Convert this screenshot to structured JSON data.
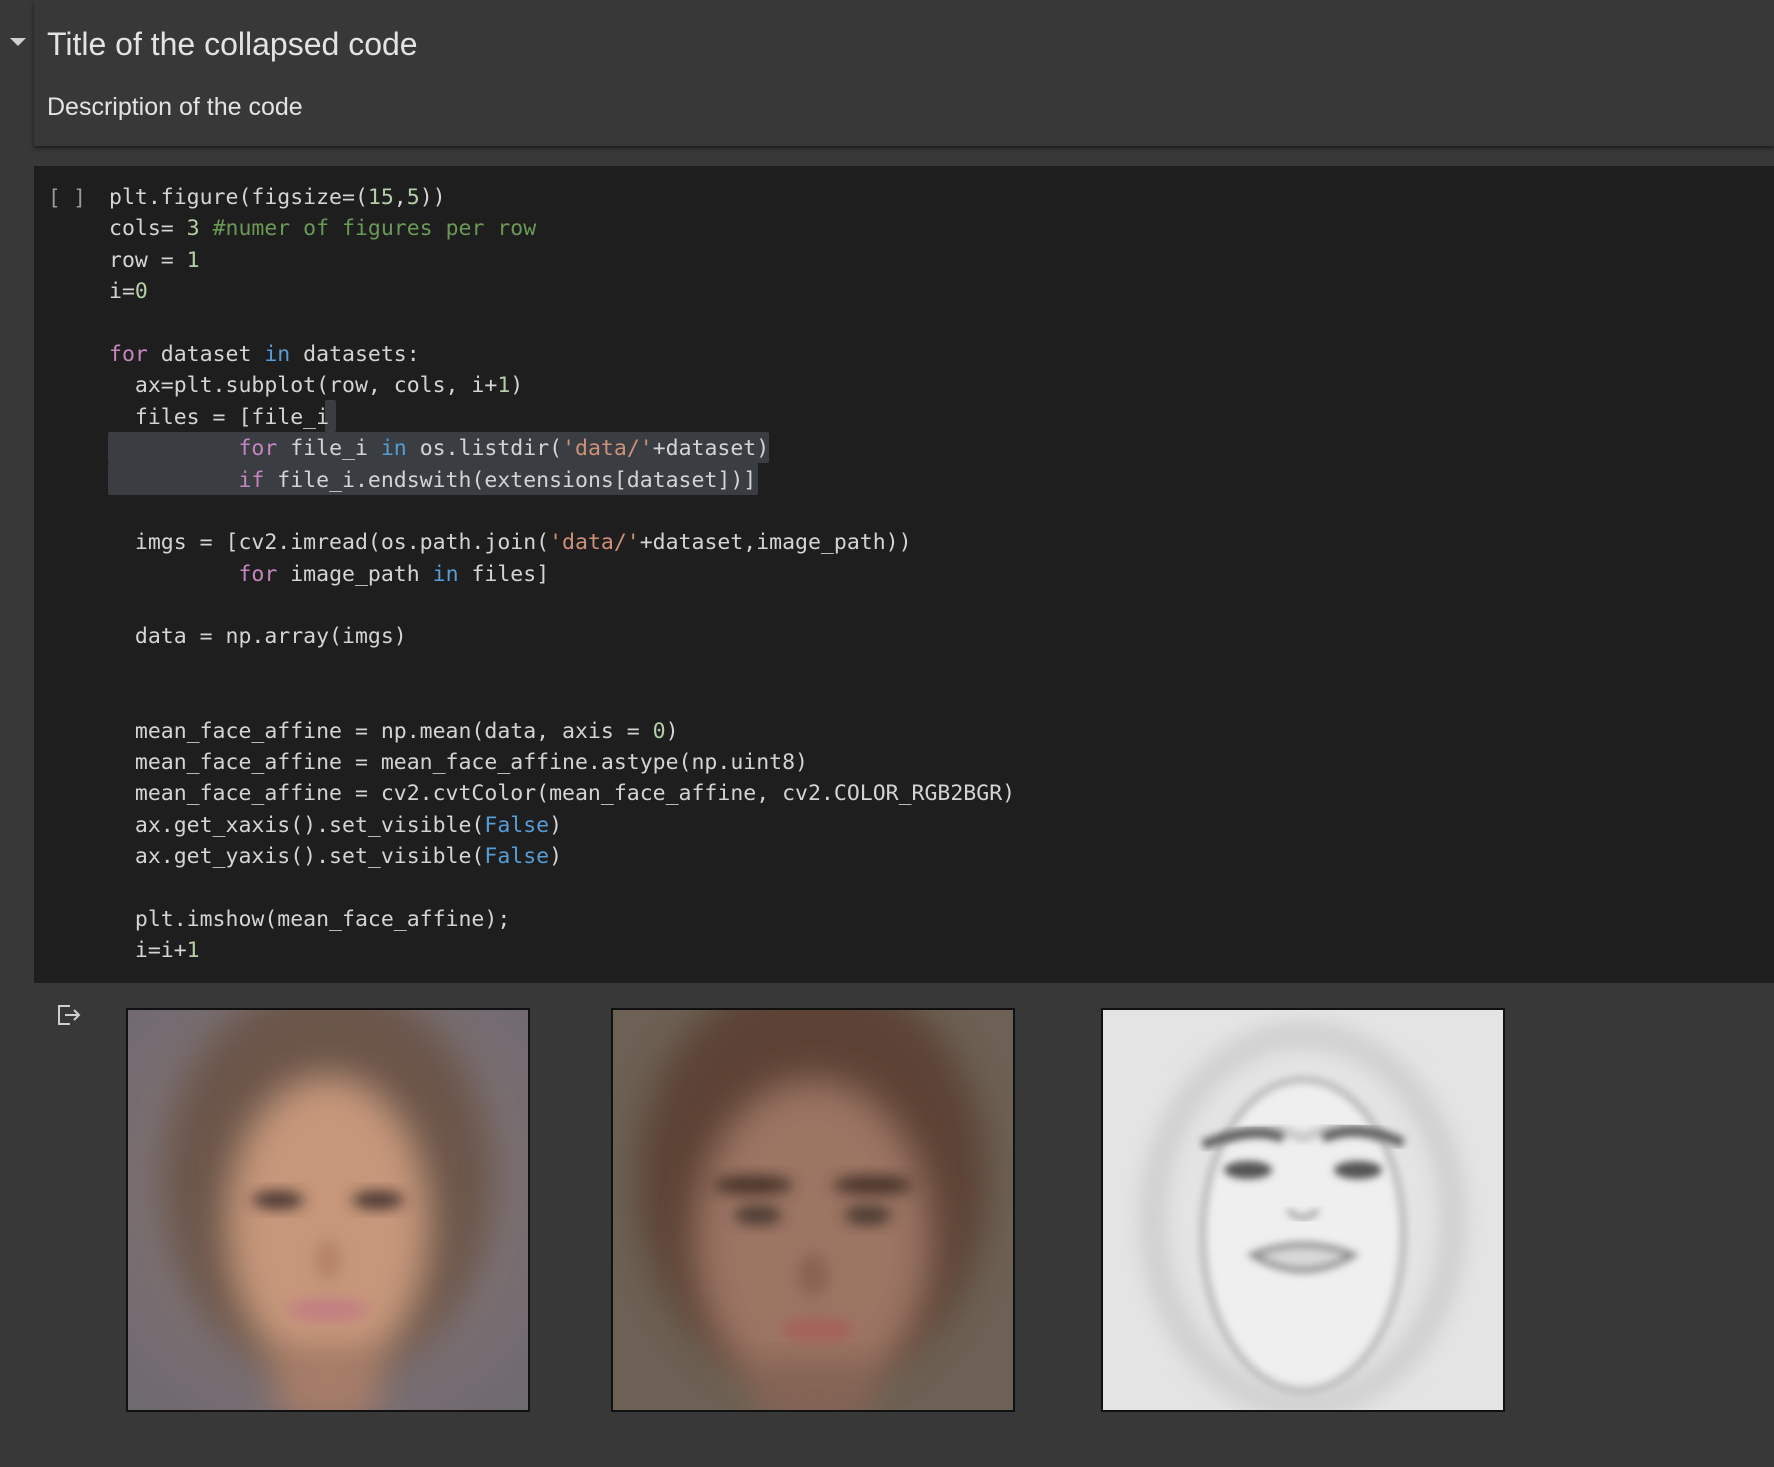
{
  "text_cell": {
    "title": "Title of the collapsed code",
    "description": "Description of the code",
    "toggle_icon": "caret-down-icon"
  },
  "code_cell": {
    "run_indicator": "[ ]",
    "lines": [
      "plt.figure(figsize=(15,5))",
      "cols= 3 #numer of figures per row",
      "row = 1",
      "i=0",
      "",
      "for dataset in datasets:",
      "  ax=plt.subplot(row, cols, i+1)",
      "  files = [file_i",
      "          for file_i in os.listdir('data/'+dataset)",
      "          if file_i.endswith(extensions[dataset])]",
      "",
      "  imgs = [cv2.imread(os.path.join('data/'+dataset,image_path))",
      "          for image_path in files]",
      "",
      "  data = np.array(imgs)",
      "",
      "",
      "  mean_face_affine = np.mean(data, axis = 0)",
      "  mean_face_affine = mean_face_affine.astype(np.uint8)",
      "  mean_face_affine = cv2.cvtColor(mean_face_affine, cv2.COLOR_RGB2BGR)",
      "  ax.get_xaxis().set_visible(False)",
      "  ax.get_yaxis().set_visible(False)",
      "",
      "  plt.imshow(mean_face_affine);",
      "  i=i+1"
    ]
  },
  "output": {
    "icon": "output-redirect-icon",
    "images": [
      {
        "name": "mean-face-1",
        "tone": "color"
      },
      {
        "name": "mean-face-2",
        "tone": "color"
      },
      {
        "name": "mean-face-3",
        "tone": "grayscale"
      }
    ]
  },
  "colors": {
    "page_bg": "#383838",
    "code_bg": "#1e1e1e",
    "keyword": "#c586c0",
    "builtin": "#569cd6",
    "number": "#b5cea8",
    "comment": "#6a9955",
    "string": "#ce9178"
  }
}
